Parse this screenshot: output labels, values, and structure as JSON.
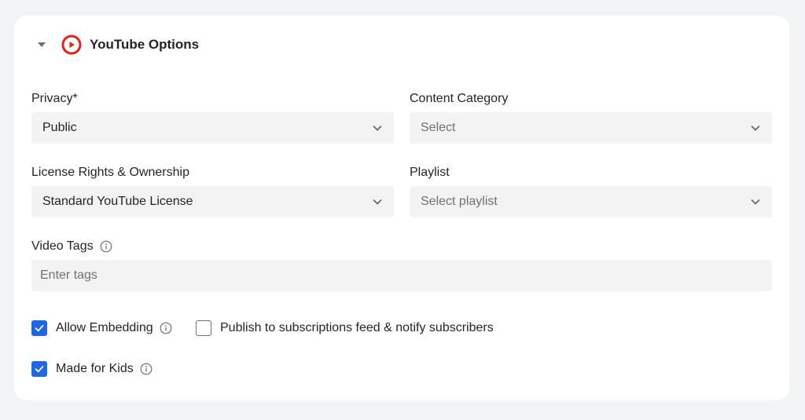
{
  "header": {
    "title": "YouTube Options",
    "icon": "youtube-logo-icon",
    "accent": "#e3231a"
  },
  "privacy": {
    "label": "Privacy*",
    "value": "Public"
  },
  "content_category": {
    "label": "Content Category",
    "placeholder": "Select"
  },
  "license": {
    "label": "License Rights & Ownership",
    "value": "Standard YouTube License"
  },
  "playlist": {
    "label": "Playlist",
    "placeholder": "Select playlist"
  },
  "video_tags": {
    "label": "Video Tags",
    "placeholder": "Enter tags"
  },
  "options": {
    "allow_embedding": {
      "label": "Allow Embedding",
      "checked": true
    },
    "publish_feed": {
      "label": "Publish to subscriptions feed & notify subscribers",
      "checked": false
    },
    "made_for_kids": {
      "label": "Made for Kids",
      "checked": true
    }
  },
  "colors": {
    "checkbox": "#1f66e0",
    "field_bg": "#f2f3f2"
  }
}
